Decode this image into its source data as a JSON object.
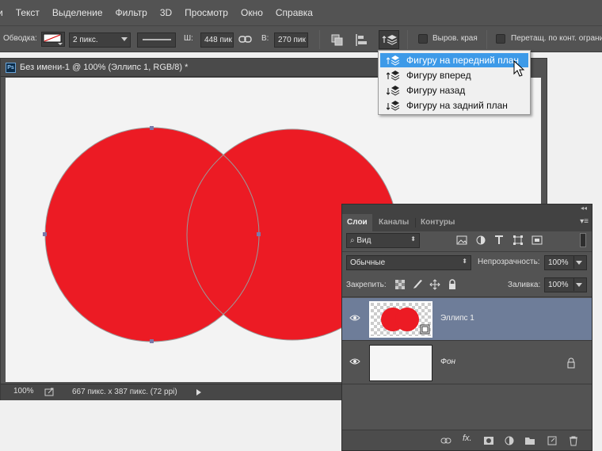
{
  "menu": [
    "и",
    "Текст",
    "Выделение",
    "Фильтр",
    "3D",
    "Просмотр",
    "Окно",
    "Справка"
  ],
  "options": {
    "stroke_label": "Обводка:",
    "stroke_size": "2 пикс.",
    "width_label": "Ш:",
    "width_value": "448 пик",
    "height_label": "В:",
    "height_value": "270 пик",
    "align_edges_label": "Выров. края",
    "constrain_label": "Перетащ. по конт. ограни"
  },
  "document": {
    "tab_title": "Без имени-1 @ 100% (Эллипс 1, RGB/8) *",
    "zoom": "100%",
    "status_info": "667 пикс. x 387 пикс. (72 ppi)",
    "shape_color": "#ec1b24"
  },
  "arrange_menu": {
    "items": [
      "Фигуру на передний план",
      "Фигуру вперед",
      "Фигуру назад",
      "Фигуру на задний план"
    ],
    "highlighted_index": 0
  },
  "layers_panel": {
    "tabs": [
      "Слои",
      "Каналы",
      "Контуры"
    ],
    "active_tab": "Слои",
    "filter_kind": "Вид",
    "blend_mode": "Обычные",
    "opacity_label": "Непрозрачность:",
    "opacity_value": "100%",
    "lock_label": "Закрепить:",
    "fill_label": "Заливка:",
    "fill_value": "100%",
    "layers": [
      {
        "name": "Эллипс 1",
        "selected": true
      },
      {
        "name": "Фон",
        "selected": false,
        "locked": true
      }
    ]
  }
}
